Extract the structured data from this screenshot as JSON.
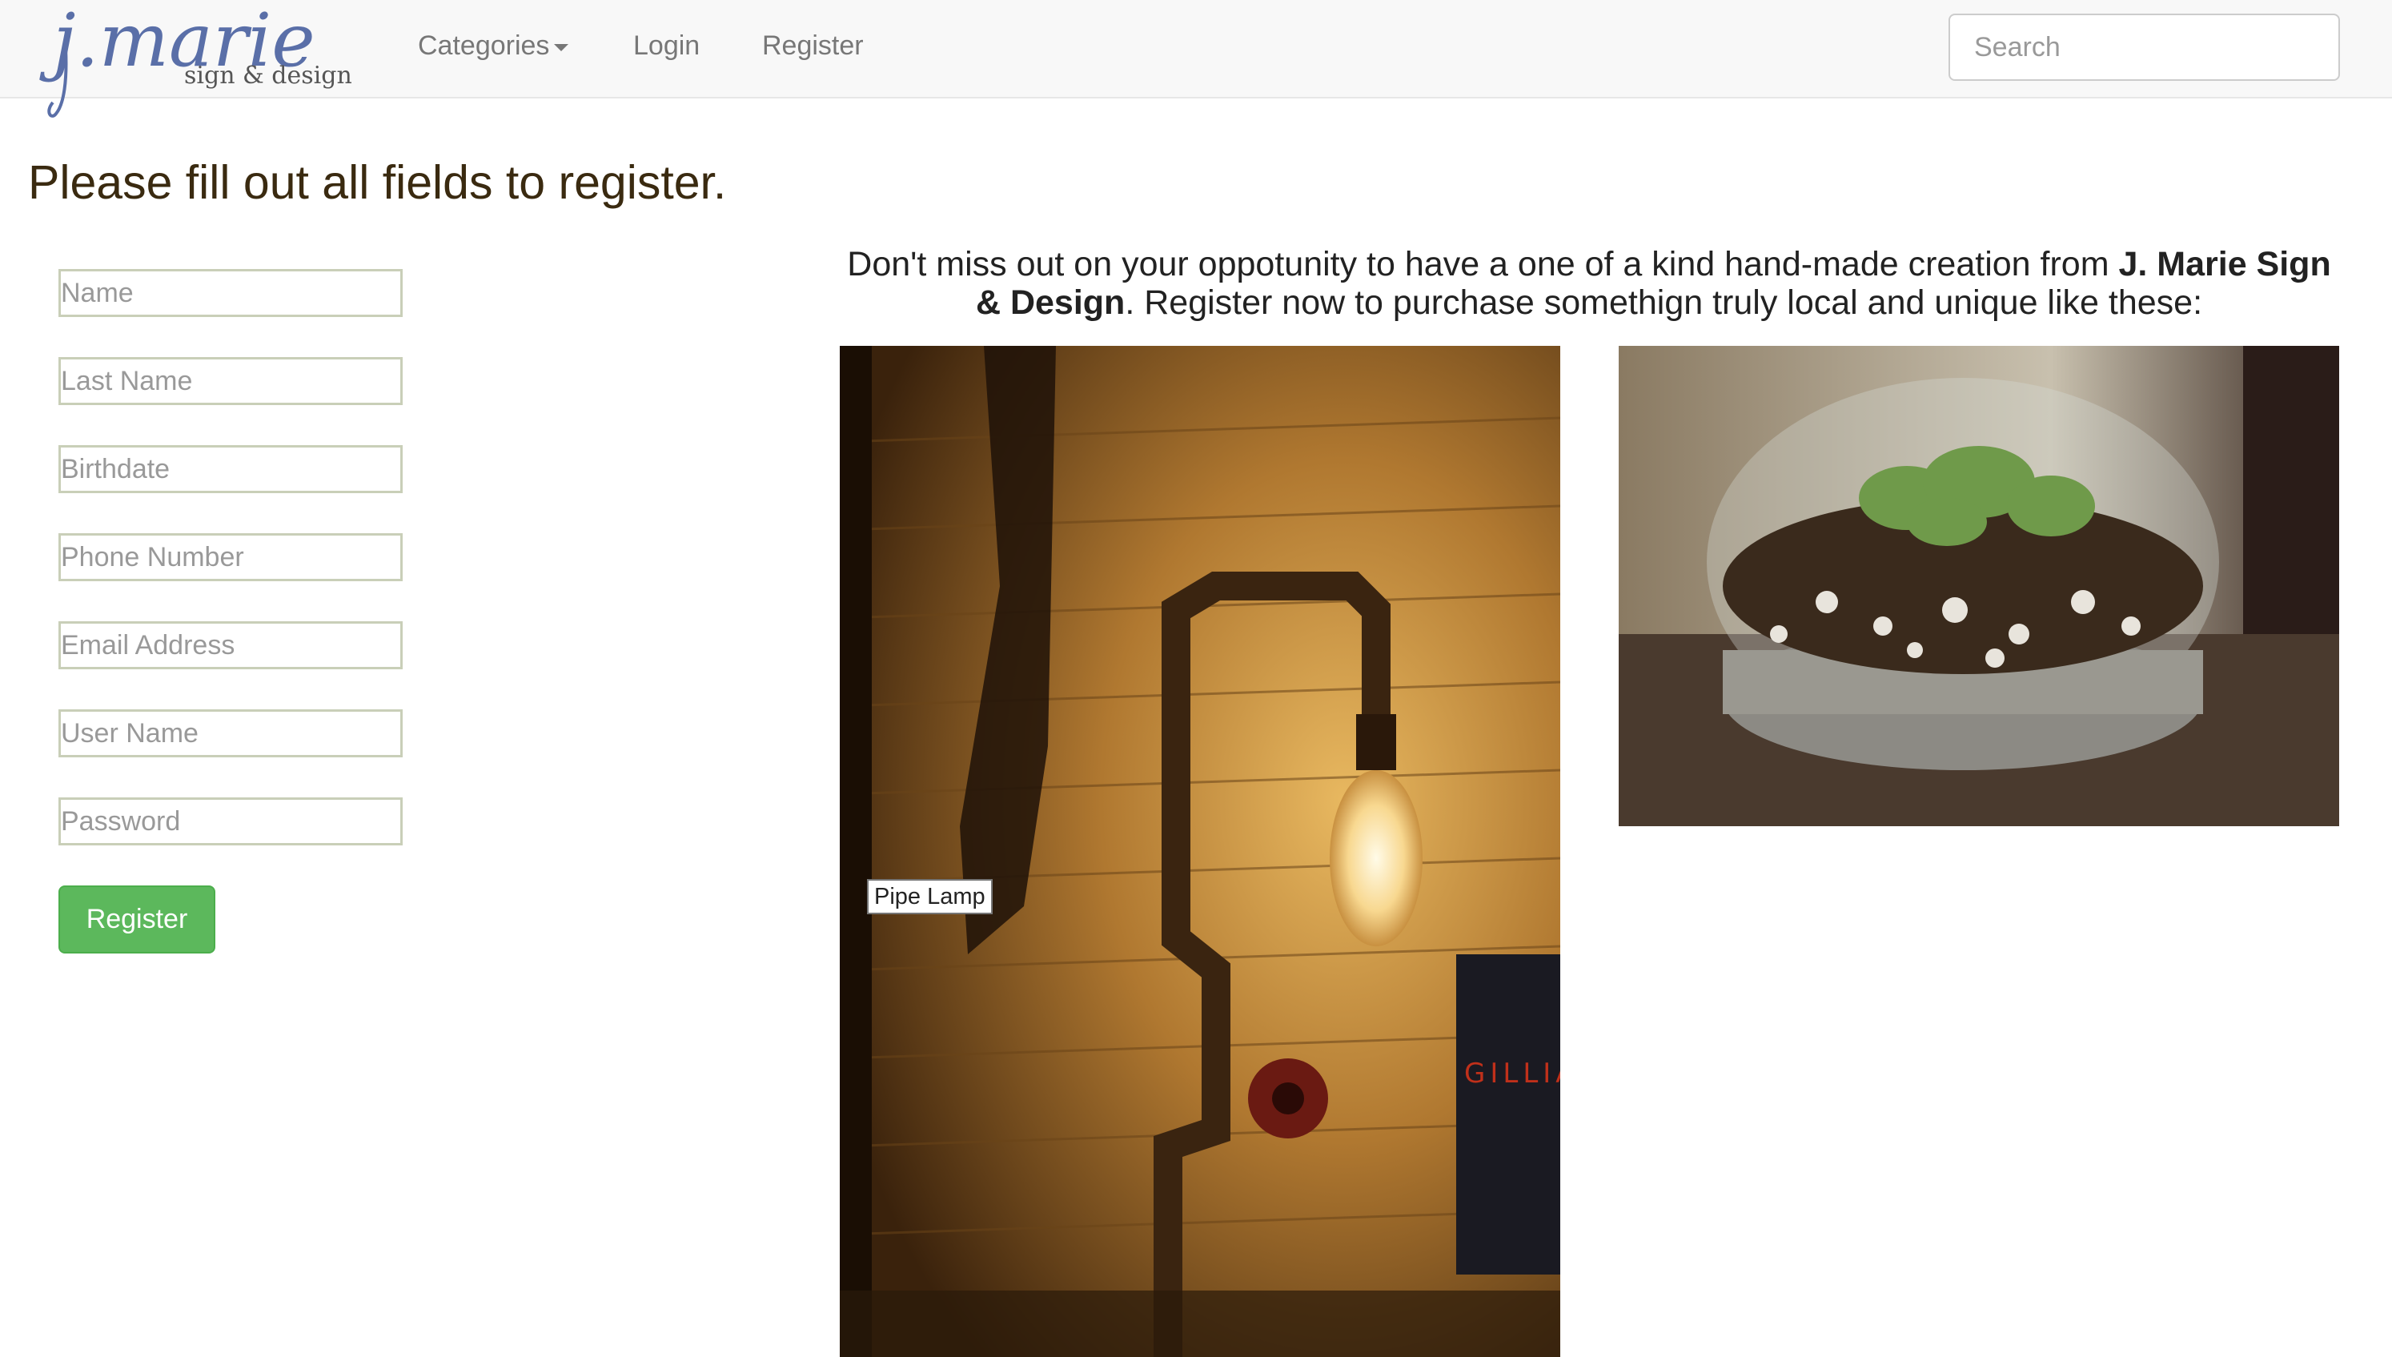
{
  "navbar": {
    "brand": "j.marie",
    "brand_sub": "sign & design",
    "categories_label": "Categories",
    "login_label": "Login",
    "register_label": "Register",
    "search_placeholder": "Search"
  },
  "page": {
    "title": "Please fill out all fields to register."
  },
  "form": {
    "name_placeholder": "Name",
    "last_name_placeholder": "Last Name",
    "birthdate_placeholder": "Birthdate",
    "phone_placeholder": "Phone Number",
    "email_placeholder": "Email Address",
    "username_placeholder": "User Name",
    "password_placeholder": "Password",
    "submit_label": "Register"
  },
  "intro": {
    "text_before": "Don't miss out on your oppotunity to have a one of a kind hand-made creation from ",
    "brand_bold": "J. Marie Sign & Design",
    "text_after": ". Register now to purchase somethign truly local and unique like these:"
  },
  "gallery": {
    "tooltip": "Pipe Lamp",
    "lamp_book_text": "GILLIAN FLYNN"
  },
  "colors": {
    "brand_blue": "#5a6fa8",
    "success_green": "#5cb85c",
    "navbar_bg": "#f8f8f8"
  }
}
